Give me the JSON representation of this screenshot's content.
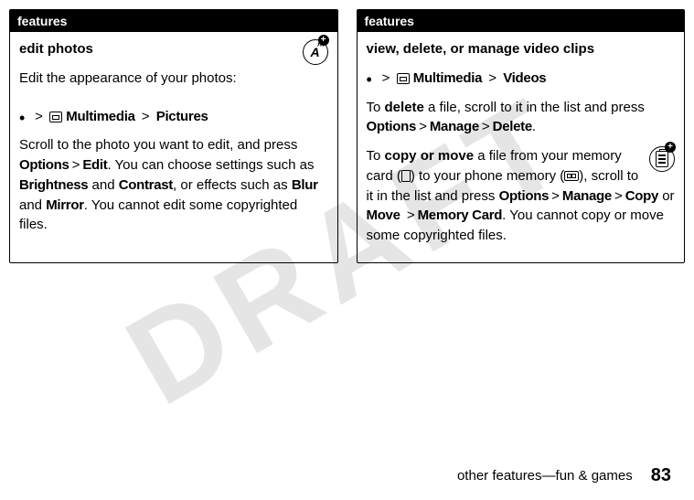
{
  "watermark": "DRAFT",
  "left": {
    "header": "features",
    "sectionTitle": "edit photos",
    "intro": "Edit the appearance of your photos:",
    "navStep1": "Multimedia",
    "navStep2": "Pictures",
    "body1a": "Scroll to the photo you want to edit, and press ",
    "options": "Options",
    "edit": "Edit",
    "body1b": ". You can choose settings such as ",
    "brightness": "Brightness",
    "and": " and ",
    "contrast": "Contrast",
    "body1c": ", or effects such as ",
    "blur": "Blur",
    "mirror": "Mirror",
    "body1d": ". You cannot edit some copyrighted files."
  },
  "right": {
    "header": "features",
    "sectionTitle": "view, delete, or manage video clips",
    "navStep1": "Multimedia",
    "navStep2": "Videos",
    "para1a": "To ",
    "delete": "delete",
    "para1b": " a file, scroll to it in the list and press ",
    "options": "Options",
    "manage": "Manage",
    "deleteMenu": "Delete",
    "para2a": "To ",
    "copyormove": "copy or move",
    "para2b": " a file from your memory card (",
    "para2c": ") to your phone memory (",
    "para2d": "), scroll to it in the list and press ",
    "copy": "Copy",
    "or": " or ",
    "move": "Move",
    "memcard": "Memory Card",
    "para2e": ". You cannot copy or move some copyrighted files."
  },
  "footer": {
    "text": "other features—fun & games",
    "page": "83"
  }
}
